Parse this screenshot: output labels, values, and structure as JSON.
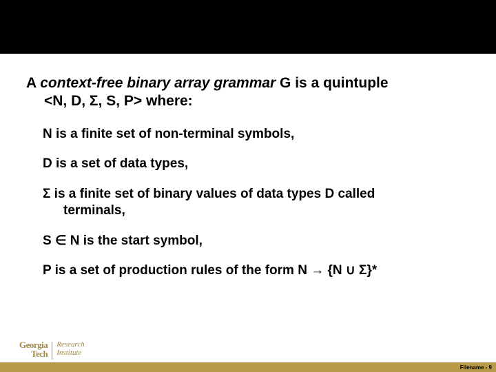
{
  "heading": {
    "prefix": "A ",
    "italic": "context-free binary array grammar",
    "suffix_line1": " G is a quintuple",
    "line2": "<N, D, Σ, S, P> where:"
  },
  "definitions": [
    {
      "text": "N is a finite set of non-terminal symbols,"
    },
    {
      "text": "D is a set of data types,"
    },
    {
      "line1": "Σ is a finite set of binary values of data types D called",
      "line2": "terminals,"
    },
    {
      "text": "S ∈ N is the start symbol,"
    },
    {
      "text": "P is a set of production rules of the form N → {N ∪ Σ}*"
    }
  ],
  "logo": {
    "line1a": "Georgia",
    "line1b": "Tech",
    "line2a": "Research",
    "line2b": "Institute"
  },
  "footer": "Filename - 9"
}
